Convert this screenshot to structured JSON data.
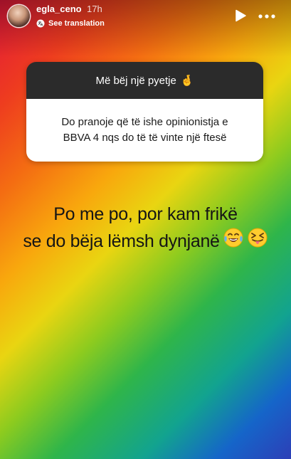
{
  "header": {
    "username": "egla_ceno",
    "time_ago": "17h",
    "see_translation": "See translation"
  },
  "question_sticker": {
    "title": "Më bëj një pyetje",
    "title_emoji": "🤞",
    "question_line1": "Do pranoje që të ishe opinionistja e",
    "question_line2": "BBVA 4 nqs do të të vinte një ftesë"
  },
  "answer": {
    "line1": "Po me po, por kam frikë",
    "line2": "se do bëja lëmsh dynjanë"
  },
  "icons": {
    "translate": "translate-icon",
    "play": "play-icon",
    "more": "more-icon",
    "tears_of_joy": "tears-of-joy-emoji-icon",
    "tongue_squint": "squinting-tongue-emoji-icon"
  },
  "colors": {
    "sticker_header_bg": "#2b2b2b",
    "sticker_body_bg": "#ffffff",
    "answer_text": "#151515"
  }
}
